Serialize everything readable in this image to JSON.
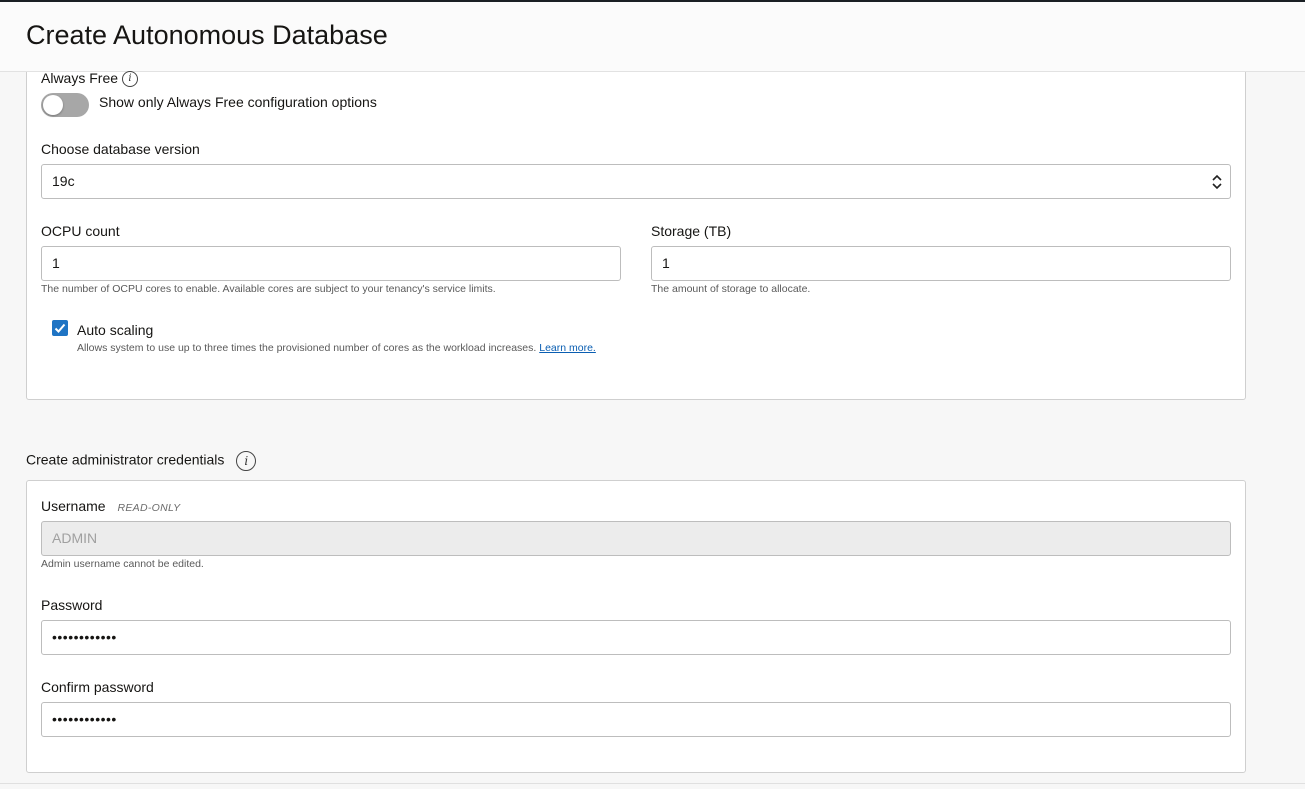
{
  "header": {
    "title": "Create Autonomous Database"
  },
  "config": {
    "always_free_label": "Always Free",
    "always_free_toggle_on": false,
    "always_free_toggle_text": "Show only Always Free configuration options",
    "db_version_label": "Choose database version",
    "db_version_value": "19c",
    "ocpu_label": "OCPU count",
    "ocpu_value": "1",
    "ocpu_help": "The number of OCPU cores to enable. Available cores are subject to your tenancy's service limits.",
    "storage_label": "Storage (TB)",
    "storage_value": "1",
    "storage_help": "The amount of storage to allocate.",
    "autoscaling_label": "Auto scaling",
    "autoscaling_checked": true,
    "autoscaling_help": "Allows system to use up to three times the provisioned number of cores as the workload increases.",
    "autoscaling_link": "Learn more."
  },
  "credentials": {
    "section_title": "Create administrator credentials",
    "username_label": "Username",
    "username_tag": "READ-ONLY",
    "username_value": "ADMIN",
    "username_help": "Admin username cannot be edited.",
    "password_label": "Password",
    "password_value": "••••••••••••",
    "confirm_label": "Confirm password",
    "confirm_value": "••••••••••••"
  },
  "icons": {
    "info": "info-icon",
    "select_arrows": "chevron-up-down-icon",
    "check": "check-icon"
  },
  "colors": {
    "accent": "#1f74c4",
    "link": "#0a5eb2",
    "toggle_off": "#a7a7a7"
  }
}
